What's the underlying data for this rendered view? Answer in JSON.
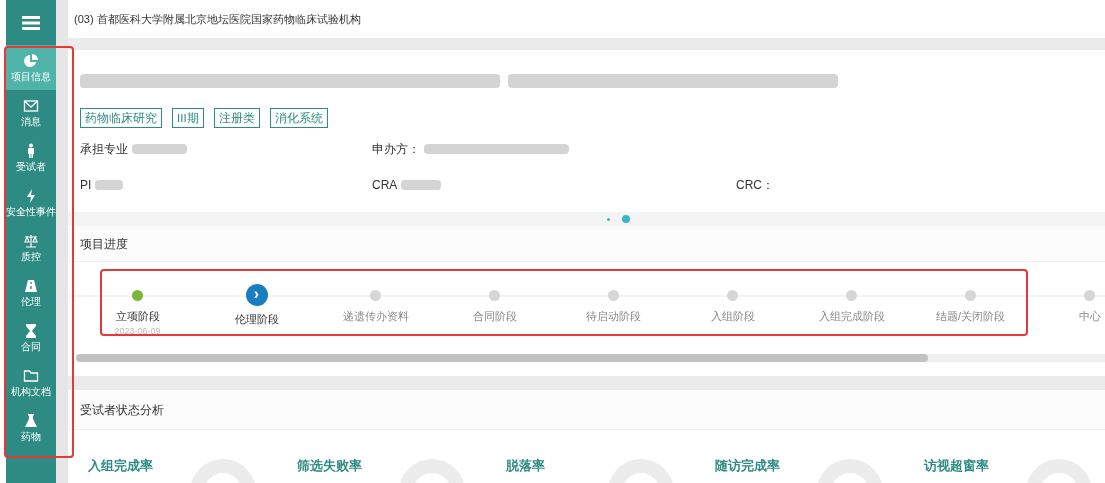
{
  "header": {
    "title": "(03) 首都医科大学附属北京地坛医院国家药物临床试验机构"
  },
  "sidebar": {
    "items": [
      {
        "label": "项目信息",
        "selected": true
      },
      {
        "label": "消息",
        "selected": false
      },
      {
        "label": "受试者",
        "selected": false
      },
      {
        "label": "安全性事件",
        "selected": false
      },
      {
        "label": "质控",
        "selected": false
      },
      {
        "label": "伦理",
        "selected": false
      },
      {
        "label": "合同",
        "selected": false
      },
      {
        "label": "机构文档",
        "selected": false
      },
      {
        "label": "药物",
        "selected": false
      }
    ]
  },
  "project": {
    "tags": [
      "药物临床研究",
      "III期",
      "注册类",
      "消化系统"
    ],
    "fields": [
      {
        "label": "承担专业"
      },
      {
        "label": "申办方："
      },
      {
        "label": "PI"
      },
      {
        "label": "CRA"
      },
      {
        "label": "CRC："
      }
    ],
    "carousel": [
      {
        "selected": false
      },
      {
        "selected": true
      }
    ]
  },
  "progress": {
    "title": "项目进度",
    "stages": [
      {
        "label": "立项阶段",
        "kind": "done",
        "date": "2023-06-09"
      },
      {
        "label": "伦理阶段",
        "kind": "current",
        "glyph": "›"
      },
      {
        "label": "递遗传办资料",
        "kind": "pending"
      },
      {
        "label": "合同阶段",
        "kind": "pending"
      },
      {
        "label": "待启动阶段",
        "kind": "pending"
      },
      {
        "label": "入组阶段",
        "kind": "pending"
      },
      {
        "label": "入组完成阶段",
        "kind": "pending"
      },
      {
        "label": "结题/关闭阶段",
        "kind": "pending"
      },
      {
        "label": "中心",
        "kind": "pending"
      }
    ]
  },
  "analysis": {
    "title": "受试者状态分析",
    "metrics": [
      {
        "label": "入组完成率"
      },
      {
        "label": "筛选失败率"
      },
      {
        "label": "脱落率"
      },
      {
        "label": "随访完成率"
      },
      {
        "label": "访视超窗率"
      }
    ]
  }
}
